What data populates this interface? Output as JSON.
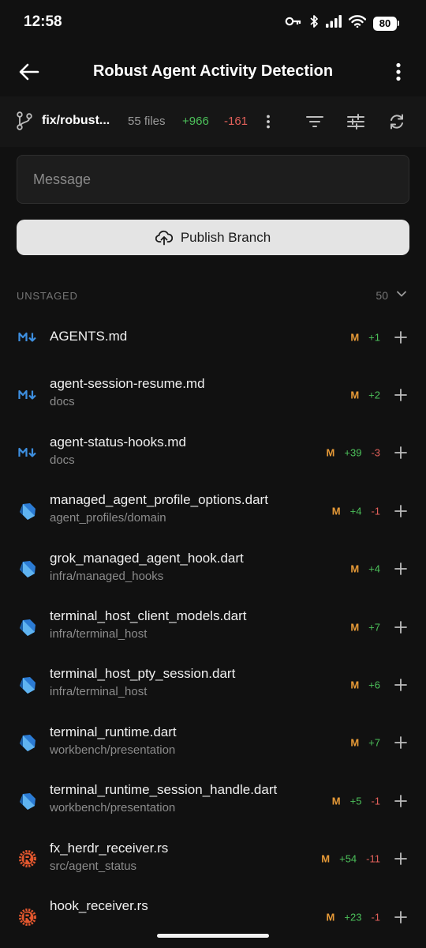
{
  "status_bar": {
    "time": "12:58",
    "battery": "80"
  },
  "app_bar": {
    "title": "Robust Agent Activity Detection"
  },
  "branch": {
    "name": "fix/robust...",
    "files": "55 files",
    "additions": "+966",
    "deletions": "-161"
  },
  "commit": {
    "message_placeholder": "Message",
    "publish_label": "Publish Branch"
  },
  "unstaged": {
    "title": "UNSTAGED",
    "count": "50",
    "files": [
      {
        "name": "AGENTS.md",
        "path": "",
        "type": "markdown",
        "status": "M",
        "additions": "+1",
        "deletions": ""
      },
      {
        "name": "agent-session-resume.md",
        "path": "docs",
        "type": "markdown",
        "status": "M",
        "additions": "+2",
        "deletions": ""
      },
      {
        "name": "agent-status-hooks.md",
        "path": "docs",
        "type": "markdown",
        "status": "M",
        "additions": "+39",
        "deletions": "-3"
      },
      {
        "name": "managed_agent_profile_options.dart",
        "path": "agent_profiles/domain",
        "type": "dart",
        "status": "M",
        "additions": "+4",
        "deletions": "-1"
      },
      {
        "name": "grok_managed_agent_hook.dart",
        "path": "infra/managed_hooks",
        "type": "dart",
        "status": "M",
        "additions": "+4",
        "deletions": ""
      },
      {
        "name": "terminal_host_client_models.dart",
        "path": "infra/terminal_host",
        "type": "dart",
        "status": "M",
        "additions": "+7",
        "deletions": ""
      },
      {
        "name": "terminal_host_pty_session.dart",
        "path": "infra/terminal_host",
        "type": "dart",
        "status": "M",
        "additions": "+6",
        "deletions": ""
      },
      {
        "name": "terminal_runtime.dart",
        "path": "workbench/presentation",
        "type": "dart",
        "status": "M",
        "additions": "+7",
        "deletions": ""
      },
      {
        "name": "terminal_runtime_session_handle.dart",
        "path": "workbench/presentation",
        "type": "dart",
        "status": "M",
        "additions": "+5",
        "deletions": "-1"
      },
      {
        "name": "fx_herdr_receiver.rs",
        "path": "src/agent_status",
        "type": "rust",
        "status": "M",
        "additions": "+54",
        "deletions": "-11"
      },
      {
        "name": "hook_receiver.rs",
        "path": "",
        "type": "rust",
        "status": "M",
        "additions": "+23",
        "deletions": "-1"
      }
    ]
  },
  "colors": {
    "background": "#111111",
    "modified": "#e79a37",
    "addition": "#4cc15a",
    "deletion": "#e2605a",
    "markdown_icon": "#3d8fe0",
    "dart_icon": "#2b7bd4",
    "rust_icon": "#e2572e"
  },
  "icons": {
    "back": "arrow-left-icon",
    "overflow": "more-vertical-icon",
    "branch": "git-branch-icon",
    "filter": "filter-icon",
    "settings": "sliders-icon",
    "refresh": "refresh-icon",
    "publish": "cloud-upload-icon",
    "stage": "plus-icon",
    "collapse": "chevron-down-icon"
  }
}
